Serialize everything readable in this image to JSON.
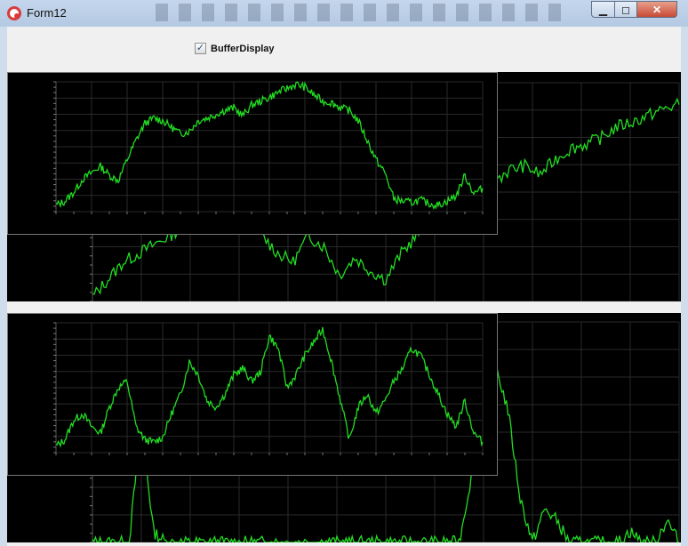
{
  "window": {
    "title": "Form12",
    "icon": "app-icon",
    "controls": {
      "minimize_icon": "minimize-icon",
      "maximize_icon": "maximize-icon",
      "close_icon": "close-icon"
    }
  },
  "toolbar": {
    "buffer_display_label": "BufferDisplay",
    "buffer_display_checked": true,
    "check_glyph": "✓"
  },
  "colors": {
    "trace": "#22dd22",
    "grid": "#2a2a2a",
    "background": "#000000",
    "form": "#f0f0f0"
  },
  "chart_data": [
    {
      "type": "line",
      "name_hint": "top-inset",
      "x": [
        0,
        10,
        20,
        30,
        40,
        50,
        60,
        70,
        80,
        90,
        100,
        110,
        120,
        130,
        140,
        150,
        160,
        170,
        180,
        190,
        200,
        210,
        220,
        230,
        240,
        250,
        260,
        270,
        280,
        290,
        300,
        310,
        320,
        330,
        340,
        350,
        360,
        370,
        380,
        390,
        400,
        410,
        420,
        430,
        440,
        450,
        460,
        470,
        480
      ],
      "values": [
        5,
        8,
        15,
        25,
        30,
        35,
        28,
        24,
        40,
        55,
        68,
        72,
        70,
        65,
        60,
        62,
        70,
        72,
        75,
        78,
        80,
        74,
        82,
        85,
        88,
        92,
        95,
        98,
        96,
        90,
        85,
        84,
        80,
        78,
        70,
        55,
        40,
        30,
        10,
        8,
        7,
        9,
        6,
        5,
        8,
        12,
        28,
        14,
        18
      ],
      "ylim": [
        0,
        100
      ],
      "grid": true
    },
    {
      "type": "line",
      "name_hint": "bottom-inset",
      "x": [
        0,
        10,
        20,
        30,
        40,
        50,
        60,
        70,
        80,
        90,
        100,
        110,
        120,
        130,
        140,
        150,
        160,
        170,
        180,
        190,
        200,
        210,
        220,
        230,
        240,
        250,
        260,
        270,
        280,
        290,
        300,
        310,
        320,
        330,
        340,
        350,
        360,
        370,
        380,
        390,
        400,
        410,
        420,
        430,
        440,
        450,
        460,
        470,
        480
      ],
      "values": [
        5,
        10,
        25,
        30,
        20,
        15,
        35,
        50,
        55,
        20,
        10,
        8,
        12,
        30,
        45,
        70,
        60,
        40,
        35,
        45,
        60,
        65,
        55,
        62,
        90,
        80,
        50,
        60,
        75,
        85,
        95,
        70,
        40,
        10,
        35,
        45,
        30,
        40,
        55,
        65,
        80,
        75,
        60,
        45,
        30,
        20,
        40,
        15,
        8
      ],
      "ylim": [
        0,
        100
      ],
      "grid": true
    },
    {
      "type": "line",
      "name_hint": "top-background",
      "x": [
        0,
        10,
        20,
        30,
        40,
        50,
        60,
        70,
        80,
        90,
        100,
        110,
        120,
        130,
        140,
        150,
        160,
        170,
        180,
        190,
        200,
        210,
        220,
        230,
        240,
        250,
        260,
        270,
        280,
        290,
        300,
        310,
        320,
        330,
        340,
        350,
        360,
        370,
        380
      ],
      "values": [
        2,
        10,
        18,
        22,
        26,
        30,
        35,
        42,
        46,
        50,
        40,
        30,
        22,
        18,
        30,
        25,
        12,
        20,
        14,
        10,
        22,
        30,
        38,
        42,
        48,
        52,
        55,
        60,
        62,
        58,
        65,
        70,
        72,
        75,
        80,
        82,
        85,
        88,
        90
      ],
      "ylim": [
        0,
        100
      ],
      "grid": true
    },
    {
      "type": "line",
      "name_hint": "bottom-background",
      "x": [
        0,
        10,
        20,
        30,
        40,
        50,
        60,
        70,
        80,
        90,
        100,
        110,
        120,
        130,
        140,
        150,
        160,
        170,
        180,
        190,
        200,
        210,
        220,
        230,
        240,
        250,
        260,
        270,
        280,
        290,
        300,
        310,
        320,
        330,
        340,
        350,
        360,
        370,
        380,
        390,
        400,
        410,
        420,
        430,
        440,
        450,
        460,
        470,
        480
      ],
      "values": [
        0,
        0,
        0,
        0,
        55,
        5,
        0,
        0,
        0,
        0,
        0,
        0,
        0,
        0,
        0,
        0,
        0,
        0,
        0,
        0,
        0,
        0,
        0,
        0,
        0,
        0,
        0,
        0,
        0,
        0,
        0,
        30,
        70,
        80,
        60,
        20,
        0,
        15,
        10,
        0,
        0,
        0,
        0,
        0,
        5,
        0,
        0,
        10,
        0
      ],
      "ylim": [
        0,
        100
      ],
      "grid": true
    }
  ]
}
